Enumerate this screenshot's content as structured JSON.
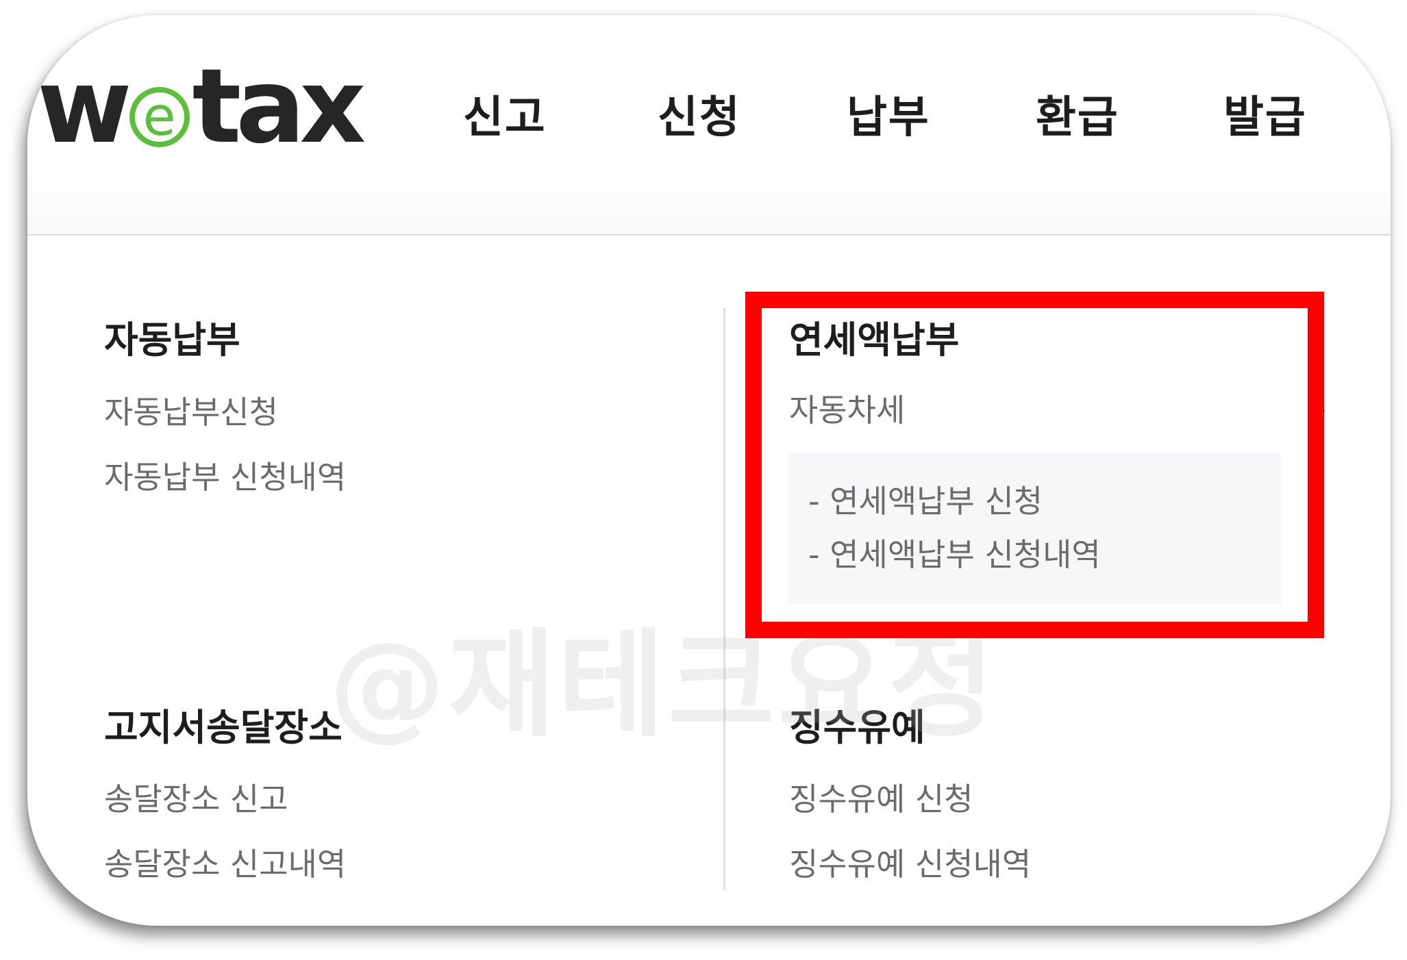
{
  "logo": {
    "pre": "w",
    "ring": "e",
    "post": "tax"
  },
  "colors": {
    "logo_green": "#5bbf3a",
    "highlight": "#ff0000",
    "logo_dark": "#262626"
  },
  "nav": [
    "신고",
    "신청",
    "납부",
    "환급",
    "발급"
  ],
  "sections": {
    "auto_pay": {
      "title": "자동납부",
      "links": [
        "자동납부신청",
        "자동납부 신청내역"
      ]
    },
    "annual_pay": {
      "title": "연세액납부",
      "links": [
        "자동차세"
      ],
      "sub_links": [
        "- 연세액납부 신청",
        "- 연세액납부 신청내역"
      ]
    },
    "delivery": {
      "title": "고지서송달장소",
      "links": [
        "송달장소 신고",
        "송달장소 신고내역"
      ]
    },
    "deferral": {
      "title": "징수유예",
      "links": [
        "징수유예 신청",
        "징수유예 신청내역"
      ]
    }
  },
  "watermark": "@재테크요정"
}
